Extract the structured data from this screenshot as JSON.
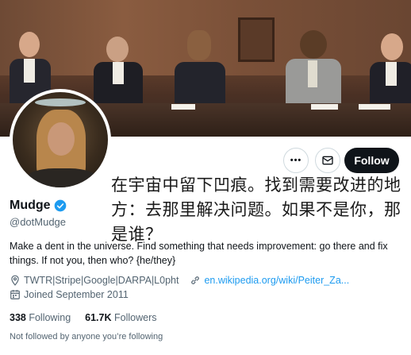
{
  "profile": {
    "display_name": "Mudge",
    "handle": "@dotMudge",
    "verified": true,
    "bio": "Make a dent in the universe. Find something that needs improvement: go there and fix things. If not you, then who? {he/they}",
    "bio_translation": "在宇宙中留下凹痕。找到需要改进的地方：去那里解决问题。如果不是你，那是谁？",
    "location": "TWTR|Stripe|Google|DARPA|L0pht",
    "website": "en.wikipedia.org/wiki/Peiter_Za...",
    "joined": "Joined September 2011",
    "following_count": "338",
    "following_label": "Following",
    "followers_count": "61.7K",
    "followers_label": "Followers",
    "follow_status": "Not followed by anyone you’re following"
  },
  "actions": {
    "more_label": "•••",
    "follow_label": "Follow"
  },
  "icons": [
    "more-icon",
    "message-icon",
    "verified-badge-icon",
    "location-icon",
    "link-icon",
    "calendar-icon"
  ],
  "colors": {
    "accent": "#1d9bf0",
    "text": "#0f1419",
    "muted": "#536471",
    "follow_bg": "#0f1419"
  }
}
